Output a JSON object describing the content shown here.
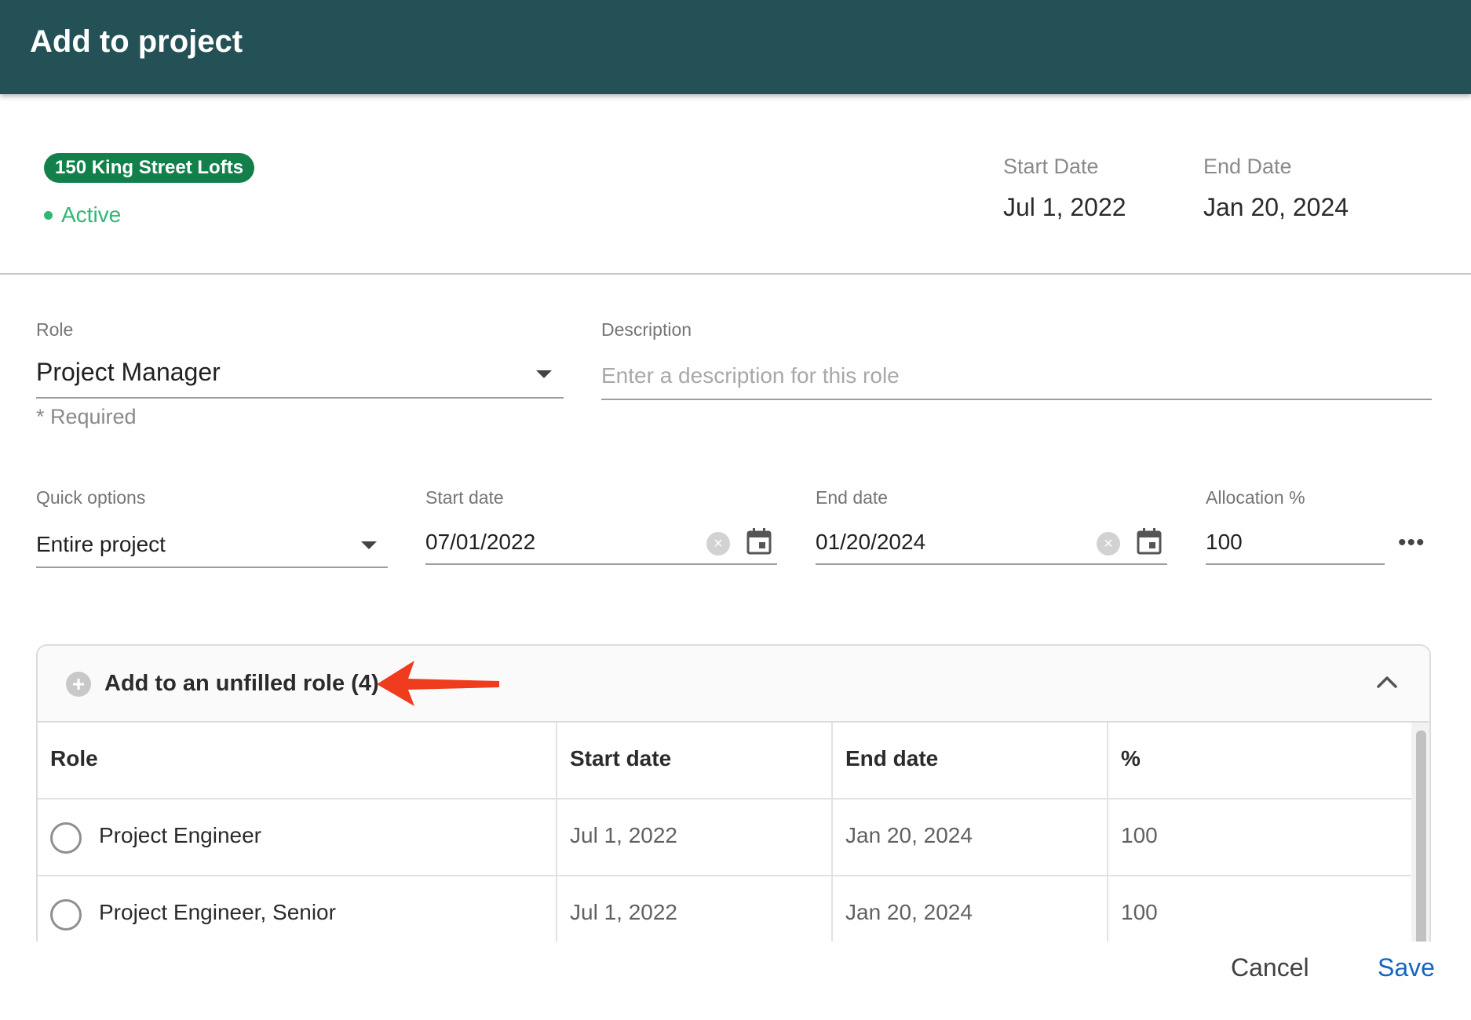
{
  "header": {
    "title": "Add to project"
  },
  "project": {
    "name": "150 King Street Lofts",
    "status": "Active",
    "start_label": "Start Date",
    "start_value": "Jul 1, 2022",
    "end_label": "End Date",
    "end_value": "Jan 20, 2024"
  },
  "form": {
    "role": {
      "label": "Role",
      "value": "Project Manager",
      "helper": "* Required"
    },
    "description": {
      "label": "Description",
      "placeholder": "Enter a description for this role"
    },
    "quick_options": {
      "label": "Quick options",
      "value": "Entire project"
    },
    "start_date": {
      "label": "Start date",
      "value": "07/01/2022"
    },
    "end_date": {
      "label": "End date",
      "value": "01/20/2024"
    },
    "allocation": {
      "label": "Allocation %",
      "value": "100"
    }
  },
  "unfilled": {
    "title": "Add to an unfilled role (4)",
    "columns": [
      "Role",
      "Start date",
      "End date",
      "%"
    ],
    "rows": [
      {
        "role": "Project Engineer",
        "start": "Jul 1, 2022",
        "end": "Jan 20, 2024",
        "pct": "100"
      },
      {
        "role": "Project Engineer, Senior",
        "start": "Jul 1, 2022",
        "end": "Jan 20, 2024",
        "pct": "100"
      }
    ]
  },
  "footer": {
    "cancel_label": "Cancel",
    "save_label": "Save"
  },
  "colors": {
    "header_bg": "#235155",
    "chip_bg": "#13804b",
    "status_green": "#2eb872",
    "save_blue": "#1565c0",
    "annotation_arrow": "#f03c1e"
  },
  "icons": [
    "plus-circle-icon",
    "chevron-up-icon",
    "calendar-icon",
    "clear-icon",
    "dropdown-caret-icon",
    "more-horizontal-icon",
    "annotation-arrow-icon"
  ]
}
